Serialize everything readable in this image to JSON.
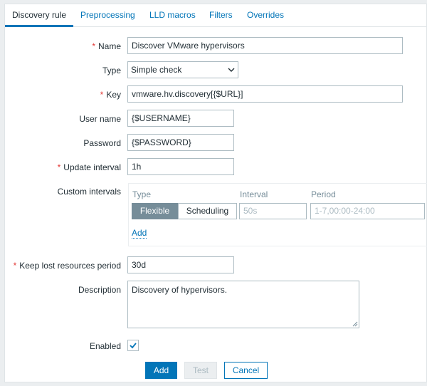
{
  "tabs": [
    {
      "label": "Discovery rule",
      "active": true
    },
    {
      "label": "Preprocessing"
    },
    {
      "label": "LLD macros"
    },
    {
      "label": "Filters"
    },
    {
      "label": "Overrides"
    }
  ],
  "required_marker": "*",
  "form": {
    "name": {
      "label": "Name",
      "value": "Discover VMware hypervisors"
    },
    "type": {
      "label": "Type",
      "value": "Simple check",
      "icon": "chevron-down-icon"
    },
    "key": {
      "label": "Key",
      "value": "vmware.hv.discovery[{$URL}]"
    },
    "username": {
      "label": "User name",
      "value": "{$USERNAME}"
    },
    "password": {
      "label": "Password",
      "value": "{$PASSWORD}"
    },
    "update_interval": {
      "label": "Update interval",
      "value": "1h"
    },
    "custom_intervals": {
      "label": "Custom intervals",
      "col_type": "Type",
      "col_interval": "Interval",
      "col_period": "Period",
      "flexible_label": "Flexible",
      "scheduling_label": "Scheduling",
      "selected": "Flexible",
      "interval_placeholder": "50s",
      "period_placeholder": "1-7,00:00-24:00",
      "add_link": "Add"
    },
    "keep_lost": {
      "label": "Keep lost resources period",
      "value": "30d"
    },
    "description": {
      "label": "Description",
      "value": "Discovery of hypervisors."
    },
    "enabled": {
      "label": "Enabled",
      "checked": true
    }
  },
  "buttons": {
    "add": "Add",
    "test": "Test",
    "cancel": "Cancel"
  },
  "colors": {
    "accent": "#0275b8",
    "required": "#e33734",
    "segment_active": "#768d99"
  }
}
